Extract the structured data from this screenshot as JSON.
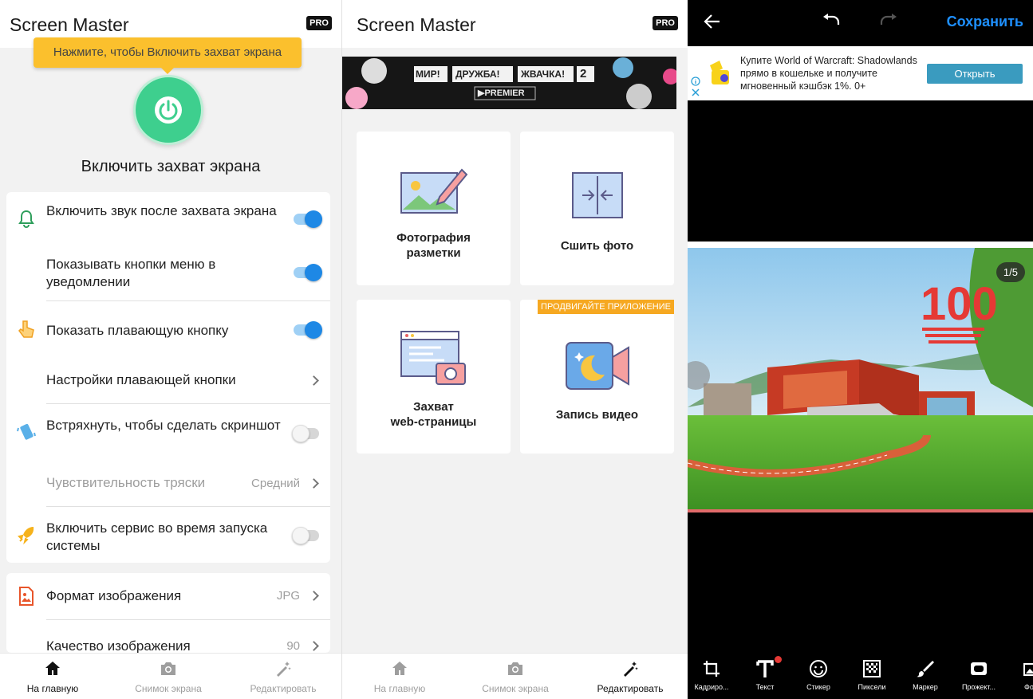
{
  "panel1": {
    "app_title": "Screen Master",
    "pro_badge": "PRO",
    "tooltip": "Нажмите, чтобы Включить захват экрана",
    "enable_title": "Включить захват экрана",
    "settings": {
      "sound": {
        "label": "Включить звук после захвата экрана",
        "on": true
      },
      "menu_buttons": {
        "label": "Показывать кнопки меню в уведомлении",
        "on": true
      },
      "floating_button": {
        "label": "Показать плавающую кнопку",
        "on": true
      },
      "floating_settings": {
        "label": "Настройки плавающей кнопки"
      },
      "shake": {
        "label": "Встряхнуть, чтобы сделать скриншот",
        "on": false
      },
      "shake_sensitivity": {
        "label": "Чувствительность тряски",
        "value": "Средний"
      },
      "boot_service": {
        "label": "Включить сервис во время запуска системы",
        "on": false
      }
    },
    "image": {
      "format": {
        "label": "Формат изображения",
        "value": "JPG"
      },
      "quality": {
        "label": "Качество изображения",
        "value": "90"
      }
    }
  },
  "nav": {
    "home": "На главную",
    "screenshot": "Снимок экрана",
    "edit": "Редактировать"
  },
  "panel2": {
    "app_title": "Screen Master",
    "pro_badge": "PRO",
    "banner": {
      "words": [
        "МИР!",
        "ДРУЖБА!",
        "ЖВАЧКА!",
        "2"
      ],
      "brand": "▶PREMIER"
    },
    "tiles": {
      "markup": {
        "line1": "Фотография",
        "line2": "разметки"
      },
      "stitch": {
        "label": "Сшить фото"
      },
      "web": {
        "line1": "Захват",
        "line2": "web-страницы"
      },
      "video": {
        "label": "Запись видео",
        "badge": "ПРОДВИГАЙТЕ ПРИЛОЖЕНИЕ"
      }
    }
  },
  "panel3": {
    "save": "Сохранить",
    "ad": {
      "text": "Купите World of Warcraft: Shadowlands прямо в кошельке и получите мгновенный кэшбэк 1%. 0+",
      "button": "Открыть"
    },
    "counter": "1/5",
    "sticker": "100",
    "tools": [
      "Кадриро...",
      "Текст",
      "Стикер",
      "Пиксели",
      "Маркер",
      "Прожект...",
      "Фо"
    ]
  },
  "colors": {
    "accent_blue": "#1e88e5",
    "power_green": "#3ecf8e",
    "tooltip_yellow": "#fbc02d",
    "save_blue": "#1e90ff",
    "promo_orange": "#f6a821"
  }
}
